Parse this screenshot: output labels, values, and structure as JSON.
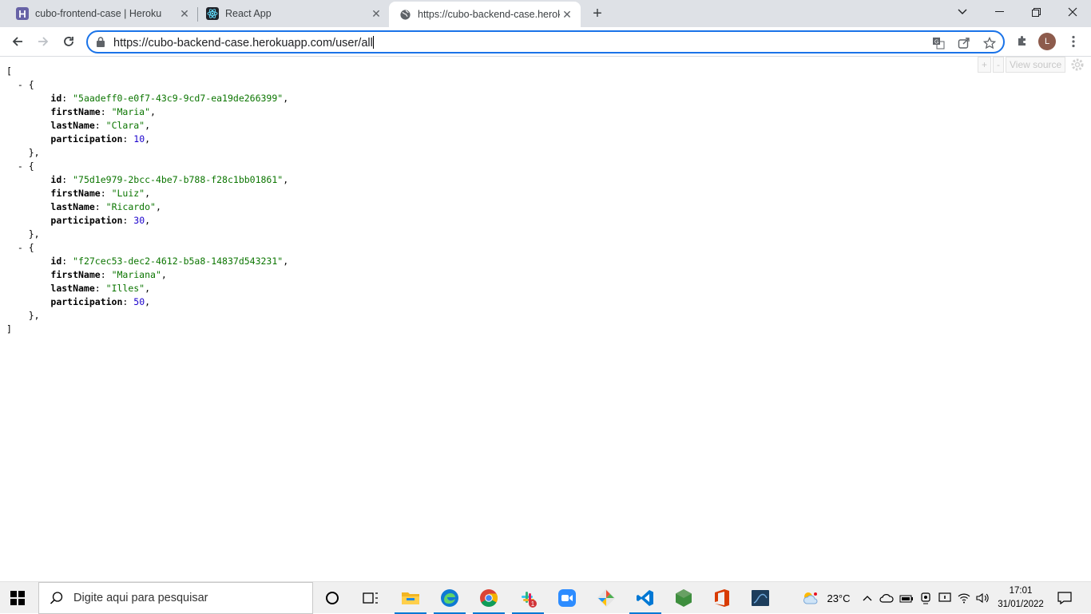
{
  "browser": {
    "tabs": [
      {
        "title": "cubo-frontend-case | Heroku",
        "icon": "heroku-icon"
      },
      {
        "title": "React App",
        "icon": "react-icon"
      },
      {
        "title": "https://cubo-backend-case.herok",
        "icon": "globe-icon"
      }
    ],
    "url": "https://cubo-backend-case.herokuapp.com/user/all",
    "profile_initial": "L"
  },
  "json_viewer": {
    "expand": "+",
    "collapse": "-",
    "view_source": "View source"
  },
  "users": [
    {
      "id": "\"5aadeff0-e0f7-43c9-9cd7-ea19de266399\"",
      "firstName": "\"Maria\"",
      "lastName": "\"Clara\"",
      "participation": "10"
    },
    {
      "id": "\"75d1e979-2bcc-4be7-b788-f28c1bb01861\"",
      "firstName": "\"Luiz\"",
      "lastName": "\"Ricardo\"",
      "participation": "30"
    },
    {
      "id": "\"f27cec53-dec2-4612-b5a8-14837d543231\"",
      "firstName": "\"Mariana\"",
      "lastName": "\"Illes\"",
      "participation": "50"
    }
  ],
  "taskbar": {
    "search_placeholder": "Digite aqui para pesquisar",
    "temperature": "23°C",
    "time": "17:01",
    "date": "31/01/2022",
    "slack_badge": "1"
  }
}
